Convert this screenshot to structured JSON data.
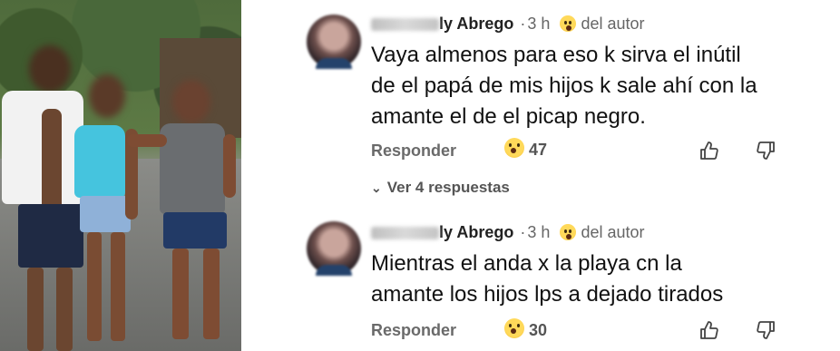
{
  "comments": [
    {
      "author_suffix": "ly Abrego",
      "time": "3 h",
      "badge": "del autor",
      "text_lines": [
        "Vaya almenos para eso k sirva el inútil",
        "de el papá de mis hijos k sale ahí con la",
        "amante el de el picap negro."
      ],
      "reply_label": "Responder",
      "reaction_count": "47",
      "reaction_icon": "wow-emoji-icon",
      "view_replies": "Ver 4 respuestas"
    },
    {
      "author_suffix": "ly Abrego",
      "time": "3 h",
      "badge": "del autor",
      "text_lines": [
        "Mientras el anda x la playa cn la",
        "amante los hijos lps a dejado tirados"
      ],
      "reply_label": "Responder",
      "reaction_count": "30",
      "reaction_icon": "wow-emoji-icon"
    }
  ],
  "colors": {
    "text": "#111111",
    "meta": "#666666",
    "emoji": "#ffd95a"
  }
}
